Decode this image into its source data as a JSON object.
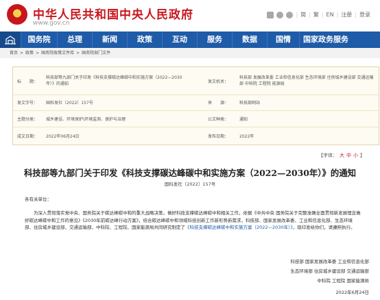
{
  "header": {
    "site_title": "中华人民共和国中央人民政府",
    "site_url": "www.gov.cn",
    "tools": [
      "简",
      "繁",
      "EN",
      "注册",
      "登录"
    ]
  },
  "nav": {
    "items": [
      "国务院",
      "总理",
      "新闻",
      "政策",
      "互动",
      "服务",
      "数据",
      "国情",
      "国家政务服务平台"
    ]
  },
  "breadcrumb": {
    "items": [
      "首页",
      "政策",
      "国务院政策文件库",
      "国务院部门文件"
    ],
    "separator": ">"
  },
  "meta": {
    "title_label": "标　　题：",
    "title_value": "科技部等九部门关于印发《科技支撑碳达峰碳中和实施方案（2022—2030年）》的通知",
    "issuer_label": "发文机关：",
    "issuer_value": "科技部 发展改革委 工业和信息化部 生态环境部 住房城乡建设部 交通运输部 中科院 工程院 能源局",
    "docno_label": "发文字号：",
    "docno_value": "国科发社〔2022〕157号",
    "source_label": "来　　源：",
    "source_value": "科技部网站",
    "topic_label": "主题分类：",
    "topic_value": "城乡建设、环境保护\\环境监测、保护与治理",
    "type_label": "公文种类：",
    "type_value": "通知",
    "written_label": "成文日期：",
    "written_value": "2022年06月24日",
    "published_label": "发布日期：",
    "published_value": "2022年"
  },
  "font_size": {
    "label": "【字体：",
    "large": "大",
    "medium": "中",
    "small": "小",
    "end": "】"
  },
  "article": {
    "title": "科技部等九部门关于印发《科技支撑碳达峰碳中和实施方案（2022—2030年）》的通知",
    "doc_number": "国科发社〔2022〕157号",
    "salutation": "各有关单位：",
    "body_before_link": "为深入贯彻落实党中央、国务院关于碳达峰碳中和的重大战略决策，做好科技支撑碳达峰碳中和相关工作，依据《中共中央 国务院关于完整准确全面贯彻新发展理念做好碳达峰碳中和工作的意见》《2030年前碳达峰行动方案》，结合碳达峰碳中和领域科技创新工作新形势新需求，科技部、国家发展改革委、工业和信息化部、生态环境部、住房城乡建设部、交通运输部、中科院、工程院、国家能源局共同研究制定了",
    "body_link": "《科技支撑碳达峰碳中和实施方案（2022—2030年）》",
    "body_after_link": "，现印发给你们，请遵照执行。",
    "signature_lines": [
      "科技部 国家发展改革委 工业和信息化部",
      "生态环境部 住房城乡建设部 交通运输部",
      "中科院 工程院 国家能源局",
      "2022年6月24日"
    ]
  }
}
